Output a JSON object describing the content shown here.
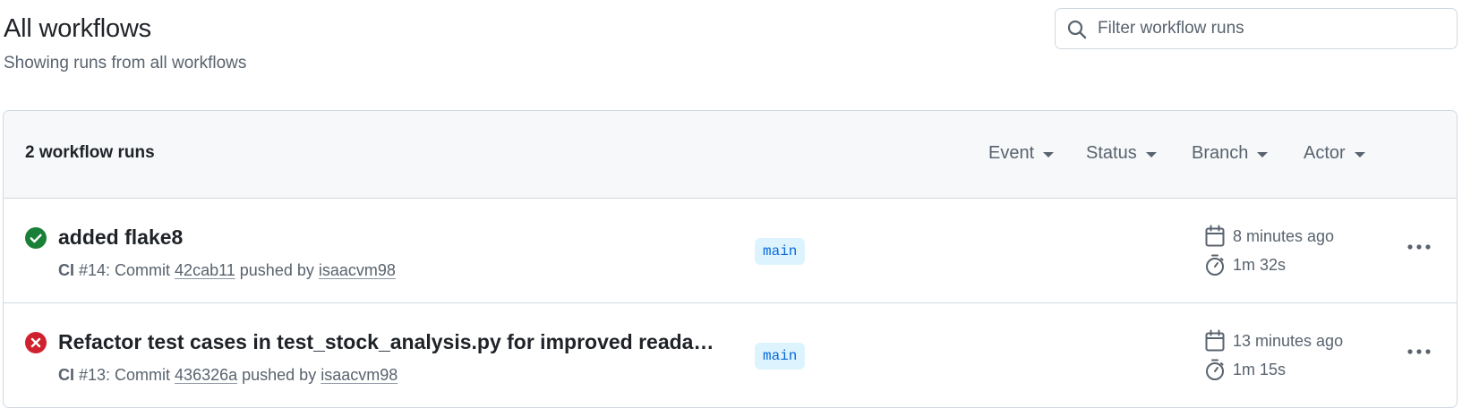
{
  "header": {
    "title": "All workflows",
    "subtitle": "Showing runs from all workflows"
  },
  "search": {
    "placeholder": "Filter workflow runs",
    "value": ""
  },
  "runs_panel": {
    "count_label": "2 workflow runs",
    "filters": [
      "Event",
      "Status",
      "Branch",
      "Actor"
    ]
  },
  "runs": [
    {
      "status": "success",
      "title": "added flake8",
      "workflow": "CI",
      "meta_run": " #14: Commit ",
      "commit": "42cab11",
      "pushed_by": " pushed by ",
      "actor": "isaacvm98",
      "branch": "main",
      "time_ago": "8 minutes ago",
      "duration": "1m 32s"
    },
    {
      "status": "failure",
      "title": "Refactor test cases in test_stock_analysis.py for improved readabil...",
      "workflow": "CI",
      "meta_run": " #13: Commit ",
      "commit": "436326a",
      "pushed_by": " pushed by ",
      "actor": "isaacvm98",
      "branch": "main",
      "time_ago": "13 minutes ago",
      "duration": "1m 15s"
    }
  ],
  "colors": {
    "success": "#1a7f37",
    "failure": "#cf222e",
    "branch_bg": "#ddf4ff",
    "branch_fg": "#0969da",
    "muted": "#59636e"
  },
  "icons": {
    "search": "search-icon",
    "success": "check-circle-fill-icon",
    "failure": "x-circle-fill-icon",
    "calendar": "calendar-icon",
    "stopwatch": "stopwatch-icon",
    "kebab": "kebab-horizontal-icon",
    "caret": "triangle-down-icon"
  }
}
